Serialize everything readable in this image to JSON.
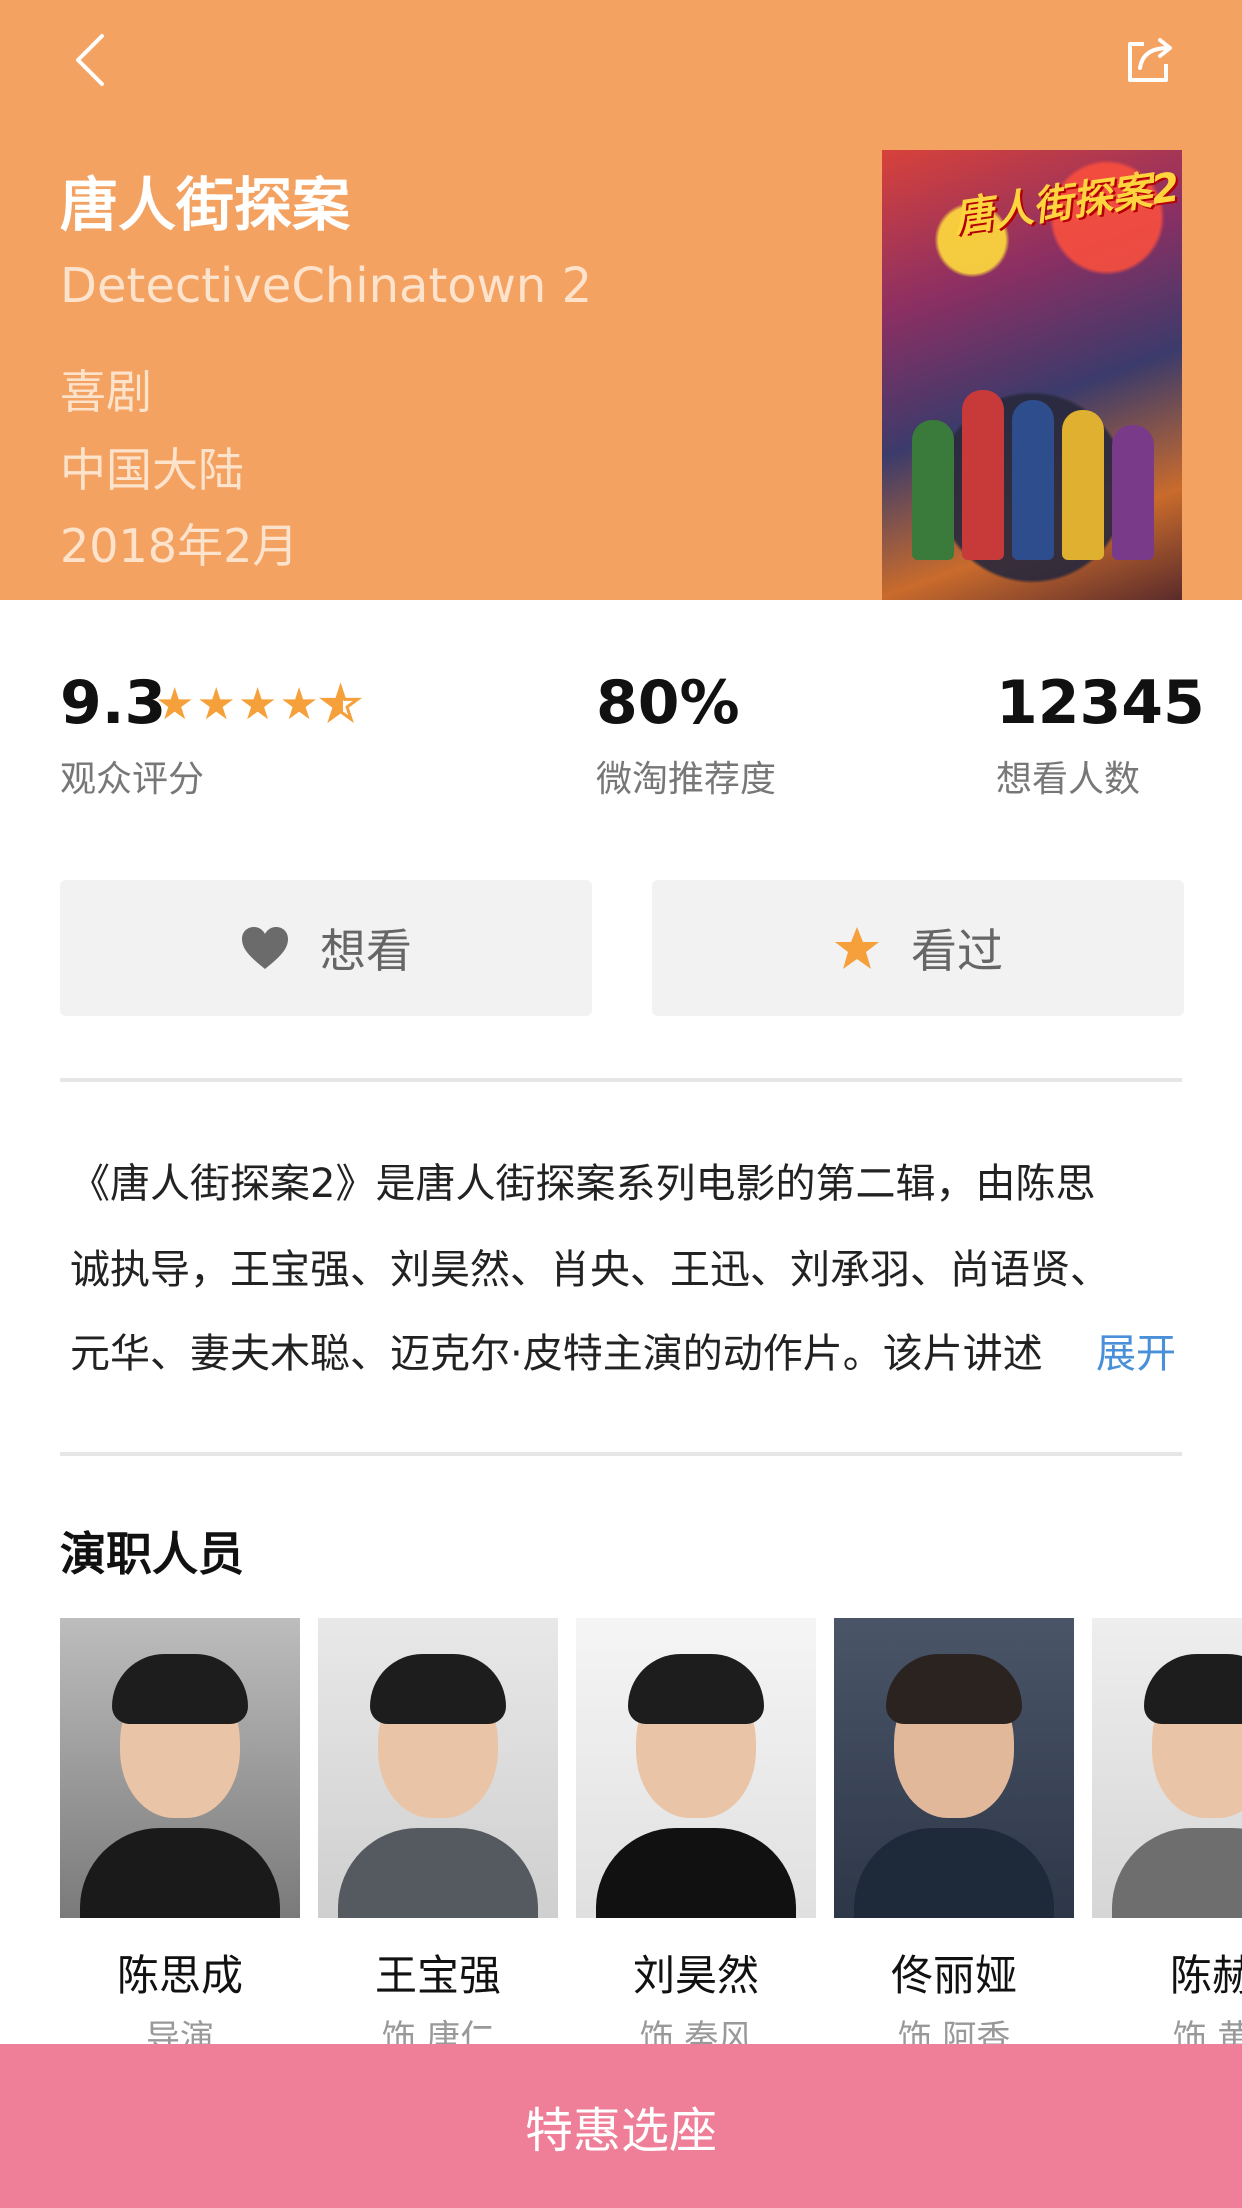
{
  "header": {
    "title": "唐人街探案",
    "subtitle": "DetectiveChinatown 2",
    "genre": "喜剧",
    "region": "中国大陆",
    "release": "2018年2月",
    "bg_color": "#f4a261",
    "poster_title": "唐人街探案2"
  },
  "icons": {
    "back": "chevron-left-icon",
    "share": "share-icon"
  },
  "stats": {
    "score": "9.3",
    "score_label": "观众评分",
    "stars": 4.5,
    "recommend": "80%",
    "recommend_label": "微淘推荐度",
    "want_count": "12345",
    "want_label": "想看人数"
  },
  "actions": {
    "want_label": "想看",
    "seen_label": "看过",
    "star_color": "#f5a03a"
  },
  "description": {
    "line1": "《唐人街探案2》是唐人街探案系列电影的第二辑，由陈思",
    "line2": "诚执导，王宝强、刘昊然、肖央、王迅、刘承羽、尚语贤、",
    "line3": "元华、妻夫木聪、迈克尔·皮特主演的动作片。该片讲述",
    "expand_label": "展开",
    "link_color": "#4a90d9"
  },
  "cast": {
    "title": "演职人员",
    "members": [
      {
        "name": "陈思成",
        "role": "导演"
      },
      {
        "name": "王宝强",
        "role": "饰 唐仁"
      },
      {
        "name": "刘昊然",
        "role": "饰 秦风"
      },
      {
        "name": "佟丽娅",
        "role": "饰 阿香"
      },
      {
        "name": "陈赫",
        "role": "饰 黄"
      }
    ]
  },
  "cta": {
    "label": "特惠选座",
    "bg_color": "#ef7e98"
  }
}
